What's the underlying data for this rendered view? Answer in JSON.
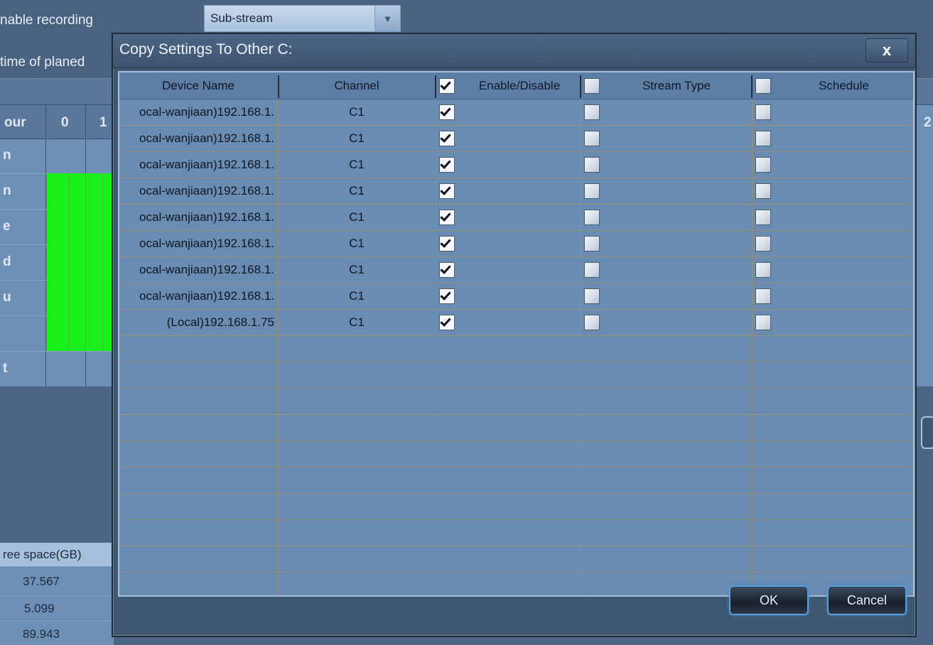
{
  "background": {
    "enable_recording_label": "nable recording",
    "time_label": "time of planed",
    "stream_select": "Sub-stream",
    "grid_header_hour": "our",
    "grid_header_cols": [
      "0",
      "1"
    ],
    "grid_right_header": "2",
    "grid_row_labels": [
      "n",
      "n",
      "e",
      "d",
      "u",
      "",
      "t"
    ],
    "free_space_header": "ree space(GB)",
    "free_space_values": [
      "37.567",
      "5.099",
      "89.943"
    ]
  },
  "dialog": {
    "title": "Copy Settings To Other C:",
    "close_label": "x",
    "columns": {
      "device_name": "Device Name",
      "channel": "Channel",
      "enable": "Enable/Disable",
      "stream_type": "Stream Type",
      "schedule": "Schedule"
    },
    "header_checks": {
      "enable": true,
      "stream_type": false,
      "schedule": false
    },
    "rows": [
      {
        "device": "ocal-wanjiaan)192.168.1.",
        "channel": "C1",
        "enable": true,
        "stream": false,
        "schedule": false
      },
      {
        "device": "ocal-wanjiaan)192.168.1.",
        "channel": "C1",
        "enable": true,
        "stream": false,
        "schedule": false
      },
      {
        "device": "ocal-wanjiaan)192.168.1.",
        "channel": "C1",
        "enable": true,
        "stream": false,
        "schedule": false
      },
      {
        "device": "ocal-wanjiaan)192.168.1.",
        "channel": "C1",
        "enable": true,
        "stream": false,
        "schedule": false
      },
      {
        "device": "ocal-wanjiaan)192.168.1.",
        "channel": "C1",
        "enable": true,
        "stream": false,
        "schedule": false
      },
      {
        "device": "ocal-wanjiaan)192.168.1.",
        "channel": "C1",
        "enable": true,
        "stream": false,
        "schedule": false
      },
      {
        "device": "ocal-wanjiaan)192.168.1.",
        "channel": "C1",
        "enable": true,
        "stream": false,
        "schedule": false
      },
      {
        "device": "ocal-wanjiaan)192.168.1.",
        "channel": "C1",
        "enable": true,
        "stream": false,
        "schedule": false
      },
      {
        "device": "(Local)192.168.1.75",
        "channel": "C1",
        "enable": true,
        "stream": false,
        "schedule": false
      }
    ],
    "ok_label": "OK",
    "cancel_label": "Cancel"
  },
  "colors": {
    "dialog_bg": "#3f5671",
    "table_bg": "#6a8cb3",
    "green_schedule": "#19f019",
    "button_border": "#5a9ed8"
  }
}
